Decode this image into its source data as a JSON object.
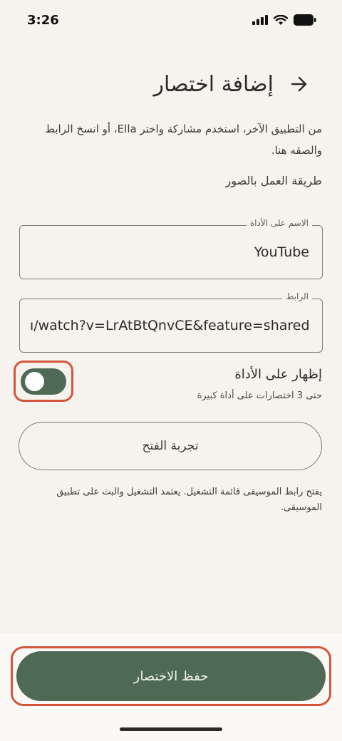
{
  "status_bar": {
    "time": "3:26",
    "icons": [
      "cellular-signal-icon",
      "wifi-icon",
      "battery-icon"
    ]
  },
  "header": {
    "title": "إضافة اختصار",
    "back_icon": "arrow-right-icon"
  },
  "description": "من التطبيق الآخر، استخدم مشاركة واختر Ella، أو انسخ الرابط والصقه هنا.",
  "how_it_works_link": "طريقة العمل بالصور",
  "name_field": {
    "label": "الاسم على الأداة",
    "value": "YouTube"
  },
  "url_field": {
    "label": "الرابط",
    "value": "ו/watch?v=LrAtBtQnvCE&feature=shared"
  },
  "show_on_widget": {
    "label": "إظهار على الأداة",
    "sublabel": "حتى 3 اختصارات على أداة كبيرة",
    "enabled": false
  },
  "test_button": "تجربة الفتح",
  "note": "يفتح رابط الموسيقى قائمة التشغيل. يعتمد التشغيل والبث على تطبيق الموسيقى.",
  "save_button": "حفظ الاختصار",
  "colors": {
    "background": "#f6f3ee",
    "accent": "#4e6a55",
    "highlight": "#d4553b"
  }
}
